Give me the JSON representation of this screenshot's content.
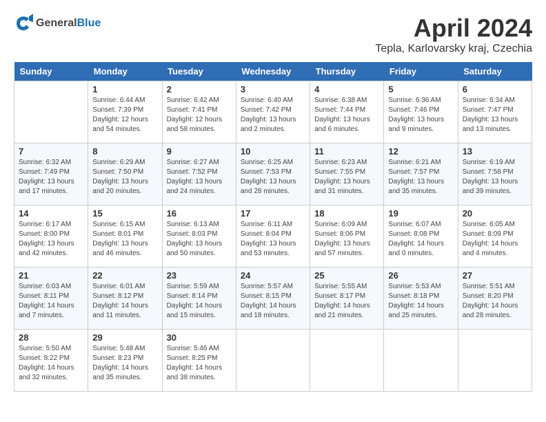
{
  "header": {
    "logo_general": "General",
    "logo_blue": "Blue",
    "month_title": "April 2024",
    "location": "Tepla, Karlovarsky kraj, Czechia"
  },
  "weekdays": [
    "Sunday",
    "Monday",
    "Tuesday",
    "Wednesday",
    "Thursday",
    "Friday",
    "Saturday"
  ],
  "weeks": [
    [
      null,
      {
        "day": "1",
        "sunrise": "6:44 AM",
        "sunset": "7:39 PM",
        "daylight": "12 hours and 54 minutes."
      },
      {
        "day": "2",
        "sunrise": "6:42 AM",
        "sunset": "7:41 PM",
        "daylight": "12 hours and 58 minutes."
      },
      {
        "day": "3",
        "sunrise": "6:40 AM",
        "sunset": "7:42 PM",
        "daylight": "13 hours and 2 minutes."
      },
      {
        "day": "4",
        "sunrise": "6:38 AM",
        "sunset": "7:44 PM",
        "daylight": "13 hours and 6 minutes."
      },
      {
        "day": "5",
        "sunrise": "6:36 AM",
        "sunset": "7:46 PM",
        "daylight": "13 hours and 9 minutes."
      },
      {
        "day": "6",
        "sunrise": "6:34 AM",
        "sunset": "7:47 PM",
        "daylight": "13 hours and 13 minutes."
      }
    ],
    [
      {
        "day": "7",
        "sunrise": "6:32 AM",
        "sunset": "7:49 PM",
        "daylight": "13 hours and 17 minutes."
      },
      {
        "day": "8",
        "sunrise": "6:29 AM",
        "sunset": "7:50 PM",
        "daylight": "13 hours and 20 minutes."
      },
      {
        "day": "9",
        "sunrise": "6:27 AM",
        "sunset": "7:52 PM",
        "daylight": "13 hours and 24 minutes."
      },
      {
        "day": "10",
        "sunrise": "6:25 AM",
        "sunset": "7:53 PM",
        "daylight": "13 hours and 28 minutes."
      },
      {
        "day": "11",
        "sunrise": "6:23 AM",
        "sunset": "7:55 PM",
        "daylight": "13 hours and 31 minutes."
      },
      {
        "day": "12",
        "sunrise": "6:21 AM",
        "sunset": "7:57 PM",
        "daylight": "13 hours and 35 minutes."
      },
      {
        "day": "13",
        "sunrise": "6:19 AM",
        "sunset": "7:58 PM",
        "daylight": "13 hours and 39 minutes."
      }
    ],
    [
      {
        "day": "14",
        "sunrise": "6:17 AM",
        "sunset": "8:00 PM",
        "daylight": "13 hours and 42 minutes."
      },
      {
        "day": "15",
        "sunrise": "6:15 AM",
        "sunset": "8:01 PM",
        "daylight": "13 hours and 46 minutes."
      },
      {
        "day": "16",
        "sunrise": "6:13 AM",
        "sunset": "8:03 PM",
        "daylight": "13 hours and 50 minutes."
      },
      {
        "day": "17",
        "sunrise": "6:11 AM",
        "sunset": "8:04 PM",
        "daylight": "13 hours and 53 minutes."
      },
      {
        "day": "18",
        "sunrise": "6:09 AM",
        "sunset": "8:06 PM",
        "daylight": "13 hours and 57 minutes."
      },
      {
        "day": "19",
        "sunrise": "6:07 AM",
        "sunset": "8:08 PM",
        "daylight": "14 hours and 0 minutes."
      },
      {
        "day": "20",
        "sunrise": "6:05 AM",
        "sunset": "8:09 PM",
        "daylight": "14 hours and 4 minutes."
      }
    ],
    [
      {
        "day": "21",
        "sunrise": "6:03 AM",
        "sunset": "8:11 PM",
        "daylight": "14 hours and 7 minutes."
      },
      {
        "day": "22",
        "sunrise": "6:01 AM",
        "sunset": "8:12 PM",
        "daylight": "14 hours and 11 minutes."
      },
      {
        "day": "23",
        "sunrise": "5:59 AM",
        "sunset": "8:14 PM",
        "daylight": "14 hours and 15 minutes."
      },
      {
        "day": "24",
        "sunrise": "5:57 AM",
        "sunset": "8:15 PM",
        "daylight": "14 hours and 18 minutes."
      },
      {
        "day": "25",
        "sunrise": "5:55 AM",
        "sunset": "8:17 PM",
        "daylight": "14 hours and 21 minutes."
      },
      {
        "day": "26",
        "sunrise": "5:53 AM",
        "sunset": "8:18 PM",
        "daylight": "14 hours and 25 minutes."
      },
      {
        "day": "27",
        "sunrise": "5:51 AM",
        "sunset": "8:20 PM",
        "daylight": "14 hours and 28 minutes."
      }
    ],
    [
      {
        "day": "28",
        "sunrise": "5:50 AM",
        "sunset": "8:22 PM",
        "daylight": "14 hours and 32 minutes."
      },
      {
        "day": "29",
        "sunrise": "5:48 AM",
        "sunset": "8:23 PM",
        "daylight": "14 hours and 35 minutes."
      },
      {
        "day": "30",
        "sunrise": "5:46 AM",
        "sunset": "8:25 PM",
        "daylight": "14 hours and 38 minutes."
      },
      null,
      null,
      null,
      null
    ]
  ]
}
